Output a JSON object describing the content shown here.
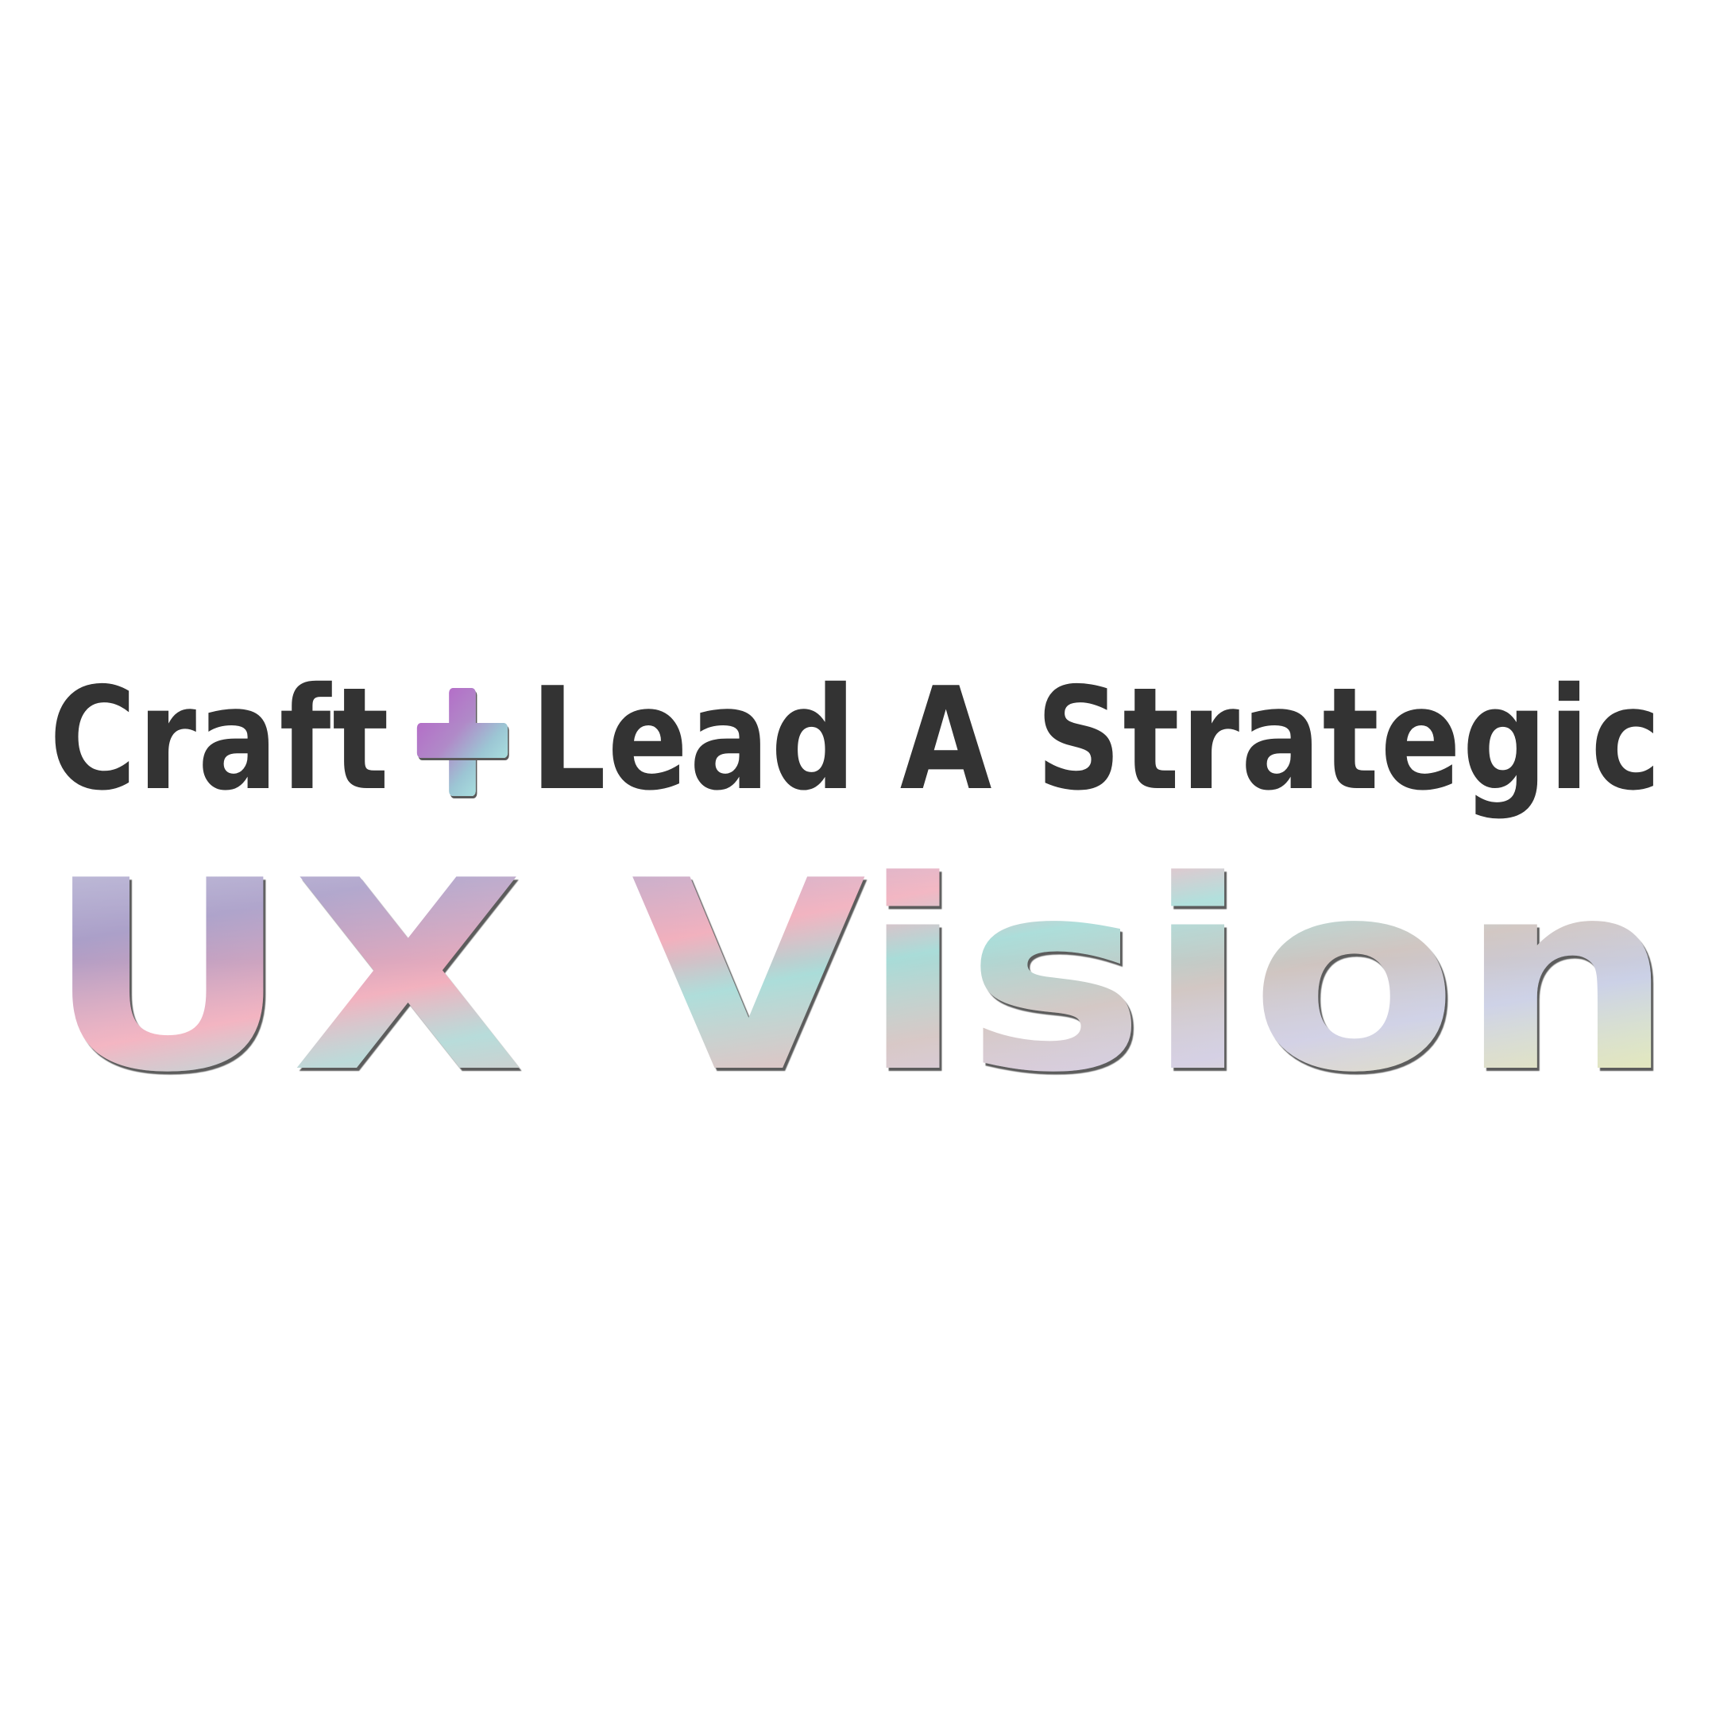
{
  "headline": {
    "line1_part1": "Craft",
    "line1_part2": "Lead A Strategic",
    "line2": "UX Vision"
  },
  "icons": {
    "joiner": "plus-icon"
  },
  "colors": {
    "background": "#ffffff",
    "text_dark": "#333333",
    "holo_pink": "#f6b3bd",
    "holo_lavender": "#b3a5cc",
    "holo_teal": "#a4dcd9",
    "holo_lime": "#e4f0a4",
    "plus_purple": "#b46ec8"
  }
}
